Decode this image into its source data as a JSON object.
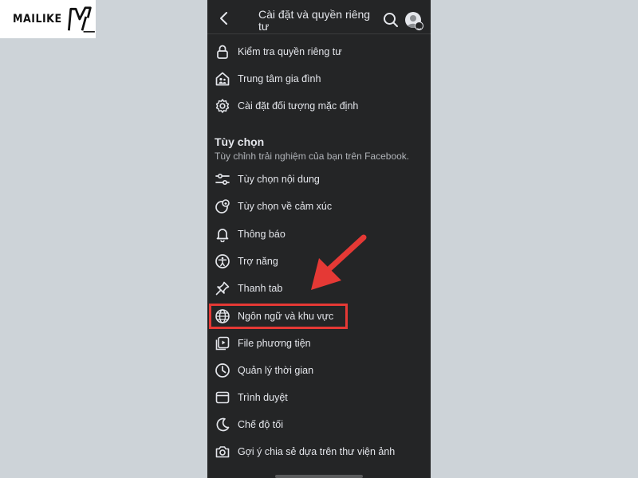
{
  "brand": {
    "text": "MAILIKE"
  },
  "header": {
    "title": "Cài đặt và quyền riêng tư",
    "back_icon": "chevron-left-icon",
    "search_icon": "search-icon",
    "avatar_icon": "avatar-icon"
  },
  "top_items": [
    {
      "label": "Kiểm tra quyền riêng tư",
      "icon": "lock-icon"
    },
    {
      "label": "Trung tâm gia đình",
      "icon": "family-home-icon"
    },
    {
      "label": "Cài đặt đối tượng mặc định",
      "icon": "gear-icon"
    }
  ],
  "section": {
    "title": "Tùy chọn",
    "subtitle": "Tùy chỉnh trải nghiệm của bạn trên Facebook."
  },
  "items": [
    {
      "label": "Tùy chọn nội dung",
      "icon": "sliders-icon"
    },
    {
      "label": "Tùy chọn về cảm xúc",
      "icon": "reaction-icon"
    },
    {
      "label": "Thông báo",
      "icon": "bell-icon"
    },
    {
      "label": "Trợ năng",
      "icon": "accessibility-icon"
    },
    {
      "label": "Thanh tab",
      "icon": "pin-icon"
    },
    {
      "label": "Ngôn ngữ và khu vực",
      "icon": "globe-icon",
      "highlighted": true
    },
    {
      "label": "File phương tiện",
      "icon": "media-icon"
    },
    {
      "label": "Quản lý thời gian",
      "icon": "clock-icon"
    },
    {
      "label": "Trình duyệt",
      "icon": "browser-icon"
    },
    {
      "label": "Chế độ tối",
      "icon": "moon-icon"
    },
    {
      "label": "Gợi ý chia sẻ dựa trên thư viện ảnh",
      "icon": "camera-icon"
    }
  ],
  "colors": {
    "panel": "#242526",
    "text": "#e4e6eb",
    "subtext": "#b0b3b8",
    "highlight": "#e53935",
    "background": "#cdd3d8"
  }
}
